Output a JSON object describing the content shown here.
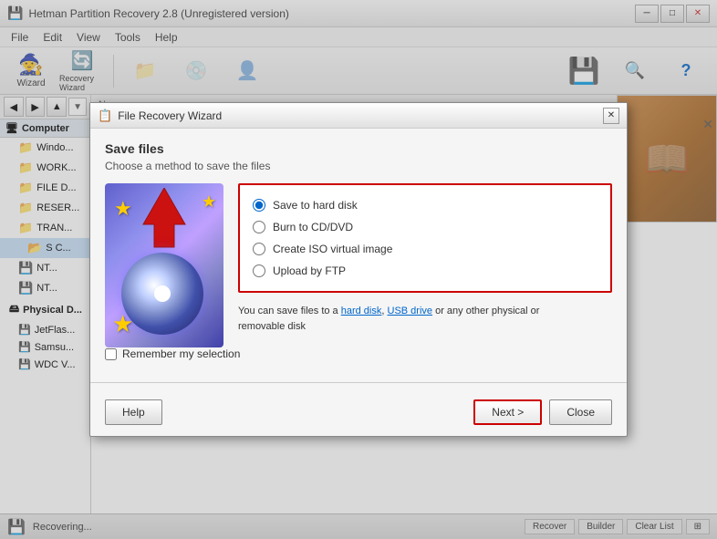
{
  "app": {
    "title": "Hetman Partition Recovery 2.8 (Unregistered version)",
    "icon": "💾"
  },
  "menu": {
    "items": [
      "File",
      "Edit",
      "View",
      "Tools",
      "Help"
    ]
  },
  "toolbar": {
    "buttons": [
      {
        "label": "Wizard",
        "icon": "🧙"
      },
      {
        "label": "Reco...",
        "icon": "🔄"
      }
    ]
  },
  "left_panel": {
    "header": "Computer",
    "items": [
      {
        "label": "Windo...",
        "indent": 1
      },
      {
        "label": "WORK...",
        "indent": 1
      },
      {
        "label": "FILE D...",
        "indent": 1
      },
      {
        "label": "RESER...",
        "indent": 1
      },
      {
        "label": "TRAN...",
        "indent": 1
      },
      {
        "label": "S C...",
        "indent": 2
      },
      {
        "label": "NT...",
        "indent": 1
      },
      {
        "label": "NT...",
        "indent": 1
      },
      {
        "label": "Physical D...",
        "indent": 0
      },
      {
        "label": "JetFlas...",
        "indent": 1
      },
      {
        "label": "Samsu...",
        "indent": 1
      },
      {
        "label": "WDC V...",
        "indent": 1
      }
    ]
  },
  "dialog": {
    "title": "File Recovery Wizard",
    "heading": "Save files",
    "subtitle": "Choose a method to save the files",
    "options": [
      {
        "label": "Save to hard disk",
        "value": "hdd",
        "selected": true
      },
      {
        "label": "Burn to CD/DVD",
        "value": "cd",
        "selected": false
      },
      {
        "label": "Create ISO virtual image",
        "value": "iso",
        "selected": false
      },
      {
        "label": "Upload by FTP",
        "value": "ftp",
        "selected": false
      }
    ],
    "info_text": "You can save files to a hard disk, USB drive or any other physical or removable disk",
    "remember_label": "Remember my selection",
    "buttons": {
      "help": "Help",
      "next": "Next >",
      "close": "Close"
    }
  },
  "status_bar": {
    "text": "Recovering...",
    "icon": "💾"
  },
  "recovery_wizard_label": "Recovery Wizard"
}
